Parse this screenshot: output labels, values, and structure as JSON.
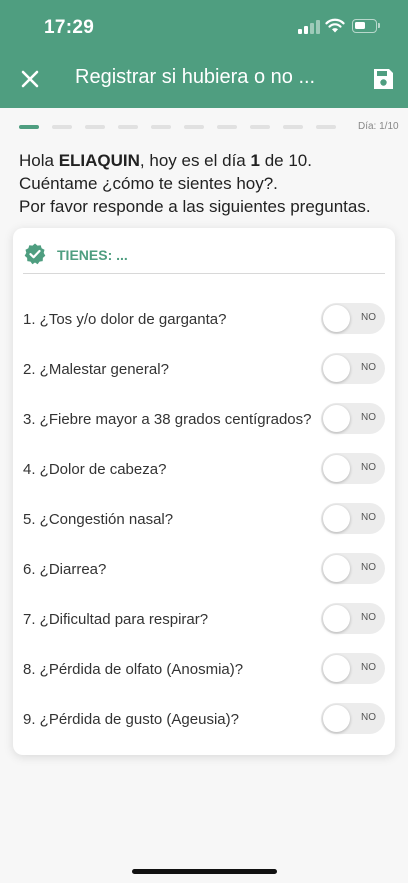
{
  "status_bar": {
    "time": "17:29"
  },
  "header": {
    "title": "Registrar si hubiera o no ...",
    "close_icon": "close-icon",
    "save_icon": "floppy-save-icon",
    "color": "#4f9e80"
  },
  "progress": {
    "current": 1,
    "total": 10,
    "label": "Día: 1/10"
  },
  "intro": {
    "greeting": "Hola ",
    "name": "ELIAQUIN",
    "day_prefix": ",  hoy es el día ",
    "day": "1",
    "day_suffix": " de 10.",
    "line2": "Cuéntame ¿cómo te sientes hoy?.",
    "line3": "Por favor responde a las siguientes preguntas."
  },
  "card": {
    "title": "TIENES: ...",
    "icon": "check-badge-icon",
    "questions": [
      {
        "text": "1. ¿Tos y/o dolor de garganta?",
        "value": "NO"
      },
      {
        "text": "2. ¿Malestar general?",
        "value": "NO"
      },
      {
        "text": "3. ¿Fiebre mayor a 38 grados centígrados?",
        "value": "NO"
      },
      {
        "text": "4. ¿Dolor de cabeza?",
        "value": "NO"
      },
      {
        "text": "5. ¿Congestión nasal?",
        "value": "NO"
      },
      {
        "text": "6. ¿Diarrea?",
        "value": "NO"
      },
      {
        "text": "7. ¿Dificultad para respirar?",
        "value": "NO"
      },
      {
        "text": "8. ¿Pérdida de olfato (Anosmia)?",
        "value": "NO"
      },
      {
        "text": "9. ¿Pérdida de gusto (Ageusia)?",
        "value": "NO"
      }
    ]
  }
}
